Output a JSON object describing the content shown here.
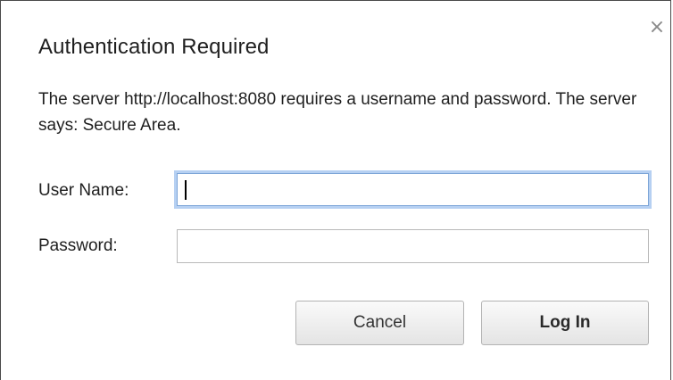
{
  "dialog": {
    "title": "Authentication Required",
    "message": "The server http://localhost:8080 requires a username and password. The server says: Secure Area.",
    "close_glyph": "×",
    "close_icon": "close-icon"
  },
  "form": {
    "username_label": "User Name:",
    "username_value": "",
    "password_label": "Password:",
    "password_value": ""
  },
  "buttons": {
    "cancel_label": "Cancel",
    "login_label": "Log In"
  },
  "colors": {
    "focus_ring": "#b6d0f2",
    "focus_border": "#7ea6d8",
    "border": "#b9b9b9"
  }
}
